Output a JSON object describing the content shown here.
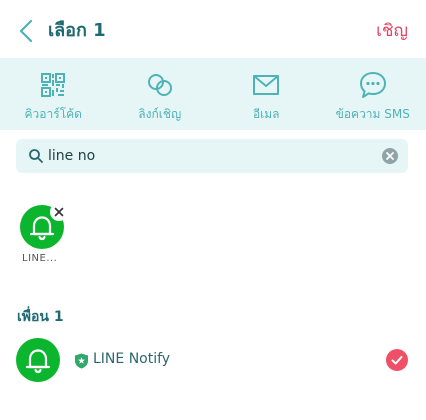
{
  "header": {
    "title": "เลือก 1",
    "invite_label": "เชิญ"
  },
  "share_options": [
    {
      "label": "คิวอาร์โค้ด",
      "icon": "qr-code-icon"
    },
    {
      "label": "ลิงก์เชิญ",
      "icon": "link-icon"
    },
    {
      "label": "อีเมล",
      "icon": "mail-icon"
    },
    {
      "label": "ข้อความ SMS",
      "icon": "sms-icon"
    }
  ],
  "search": {
    "value": "line no",
    "placeholder": ""
  },
  "selected": [
    {
      "label": "LINE..."
    }
  ],
  "friends_section": {
    "title": "เพื่อน 1",
    "items": [
      {
        "name": "LINE Notify",
        "checked": true
      }
    ]
  },
  "colors": {
    "accent": "#1f6a73",
    "share_icon": "#4fb2b6",
    "share_bar_bg": "#e6f6f6",
    "invite": "#e24463",
    "avatar_green": "#0bb62e",
    "check_red": "#f04f68",
    "badge_green": "#2fa86a"
  }
}
